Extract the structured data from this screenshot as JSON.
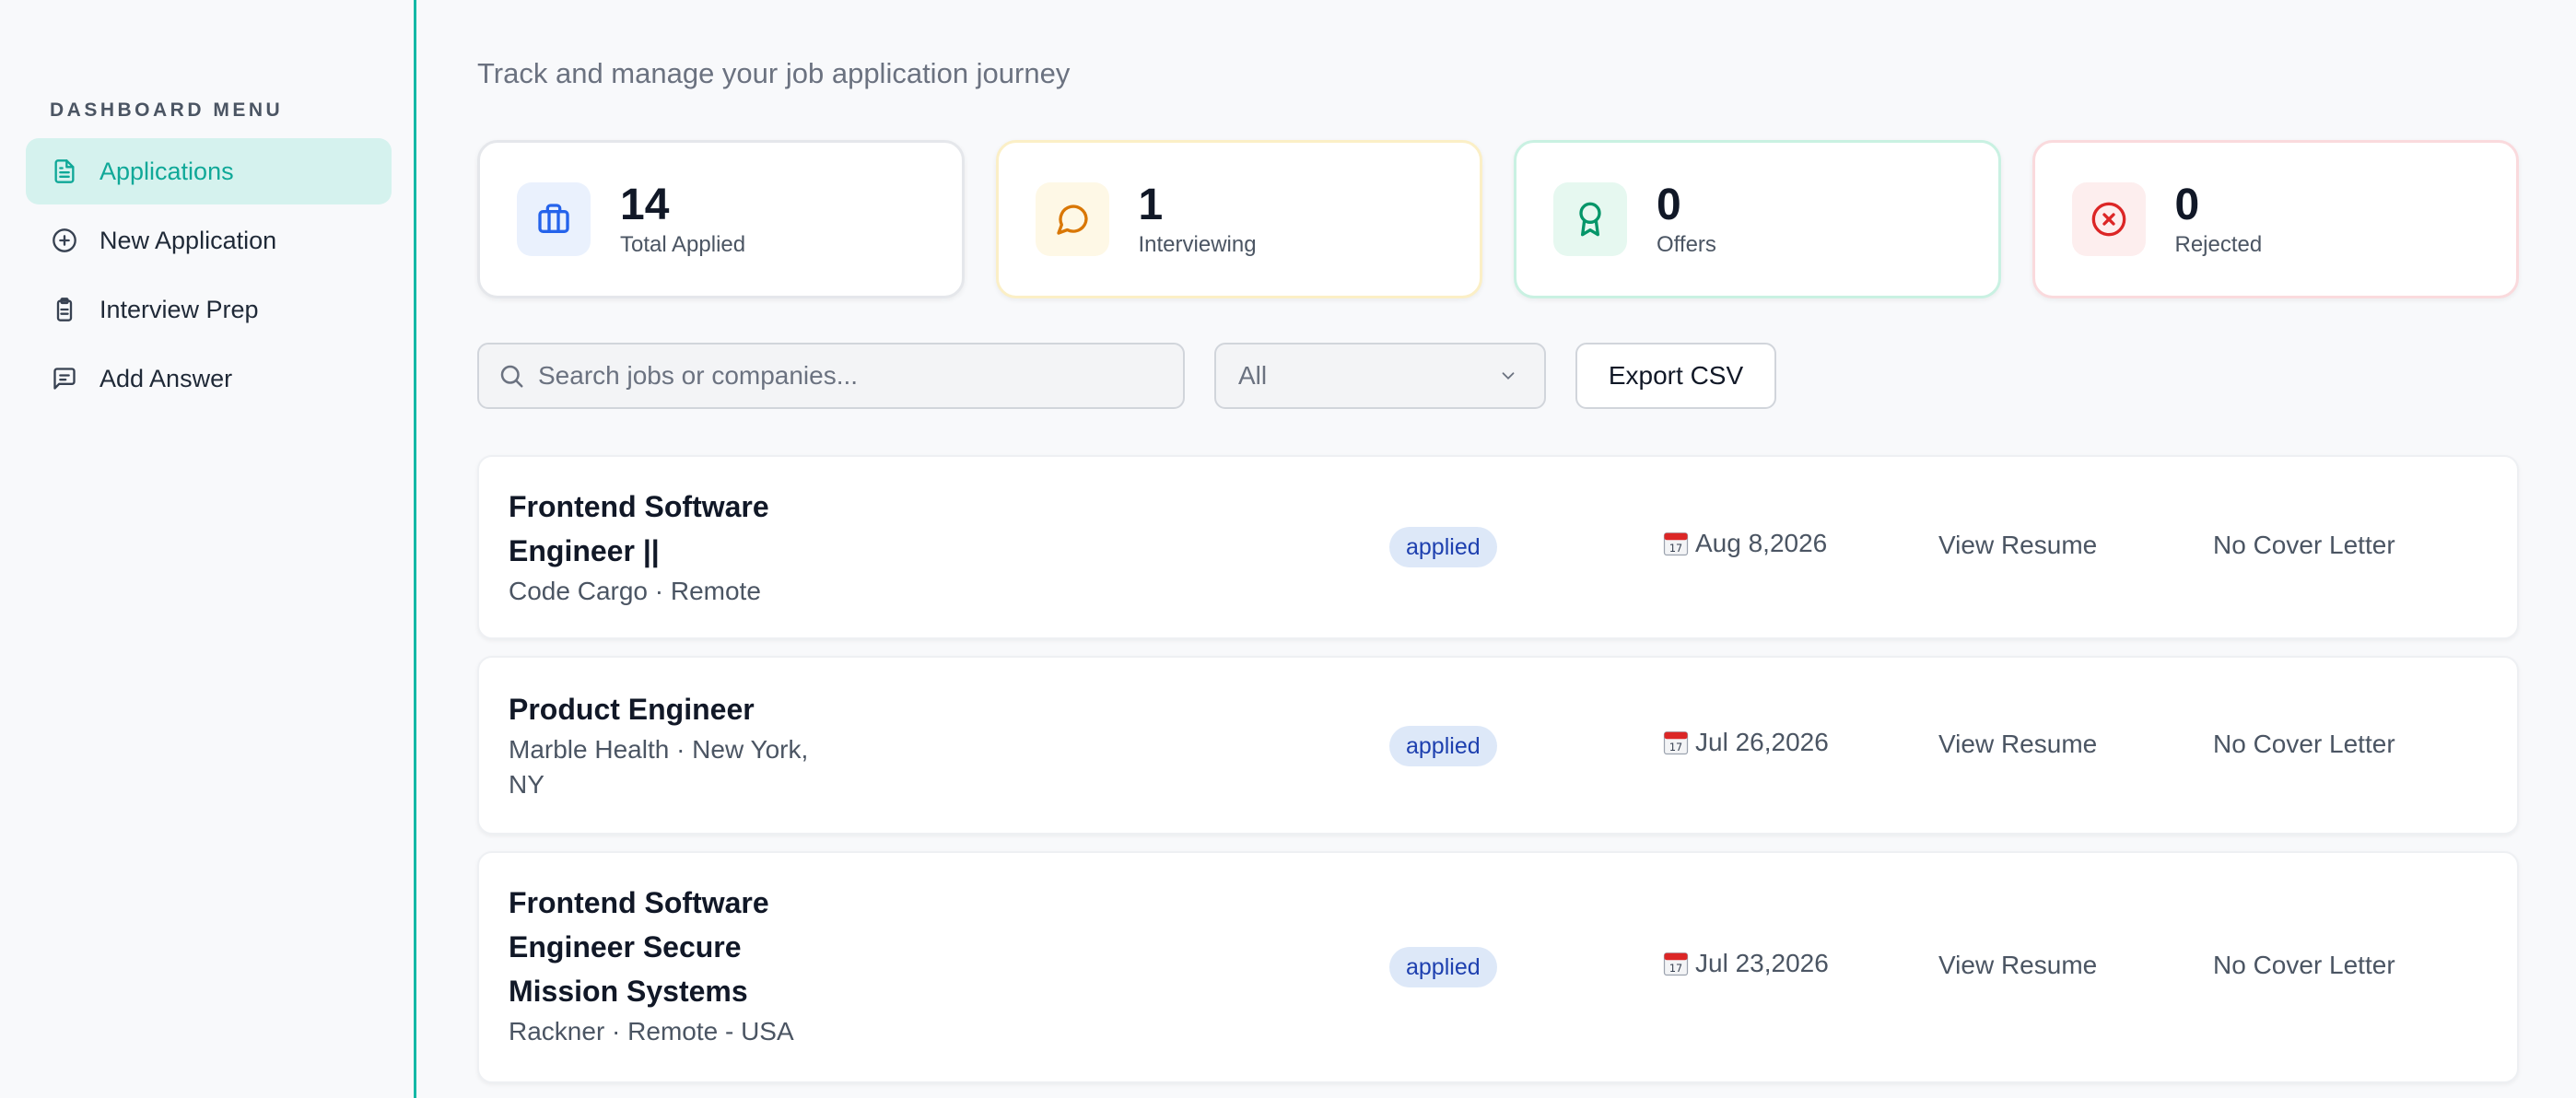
{
  "sidebar": {
    "heading": "DASHBOARD MENU",
    "items": [
      {
        "label": "Applications",
        "icon": "file-icon",
        "active": true
      },
      {
        "label": "New Application",
        "icon": "plus-circle-icon"
      },
      {
        "label": "Interview Prep",
        "icon": "clipboard-icon"
      },
      {
        "label": "Add Answer",
        "icon": "message-icon"
      }
    ]
  },
  "header": {
    "subtitle": "Track and manage your job application journey"
  },
  "stats": [
    {
      "value": "14",
      "label": "Total Applied",
      "icon": "briefcase-icon",
      "color": "#2563eb"
    },
    {
      "value": "1",
      "label": "Interviewing",
      "icon": "chat-icon",
      "color": "#d97706"
    },
    {
      "value": "0",
      "label": "Offers",
      "icon": "award-icon",
      "color": "#059669"
    },
    {
      "value": "0",
      "label": "Rejected",
      "icon": "x-circle-icon",
      "color": "#dc2626"
    }
  ],
  "toolbar": {
    "search_placeholder": "Search jobs or companies...",
    "filter_value": "All",
    "export_label": "Export CSV"
  },
  "jobs": [
    {
      "title_lines": [
        "Frontend Software",
        "Engineer ||"
      ],
      "sub_lines": [
        "Code Cargo · Remote"
      ],
      "status": "applied",
      "date": "Aug 8,2026",
      "resume": "View Resume",
      "cover": "No Cover Letter"
    },
    {
      "title_lines": [
        "Product Engineer"
      ],
      "sub_lines": [
        "Marble Health · New York,",
        "NY"
      ],
      "status": "applied",
      "date": "Jul 26,2026",
      "resume": "View Resume",
      "cover": "No Cover Letter"
    },
    {
      "title_lines": [
        "Frontend Software",
        "Engineer Secure",
        "Mission Systems"
      ],
      "sub_lines": [
        "Rackner · Remote - USA"
      ],
      "status": "applied",
      "date": "Jul 23,2026",
      "resume": "View Resume",
      "cover": "No Cover Letter"
    }
  ],
  "colors": {
    "accent": "#14b8a6",
    "active_bg": "#d5f2ee",
    "badge_bg": "#dde8f8",
    "badge_text": "#1e40af"
  }
}
